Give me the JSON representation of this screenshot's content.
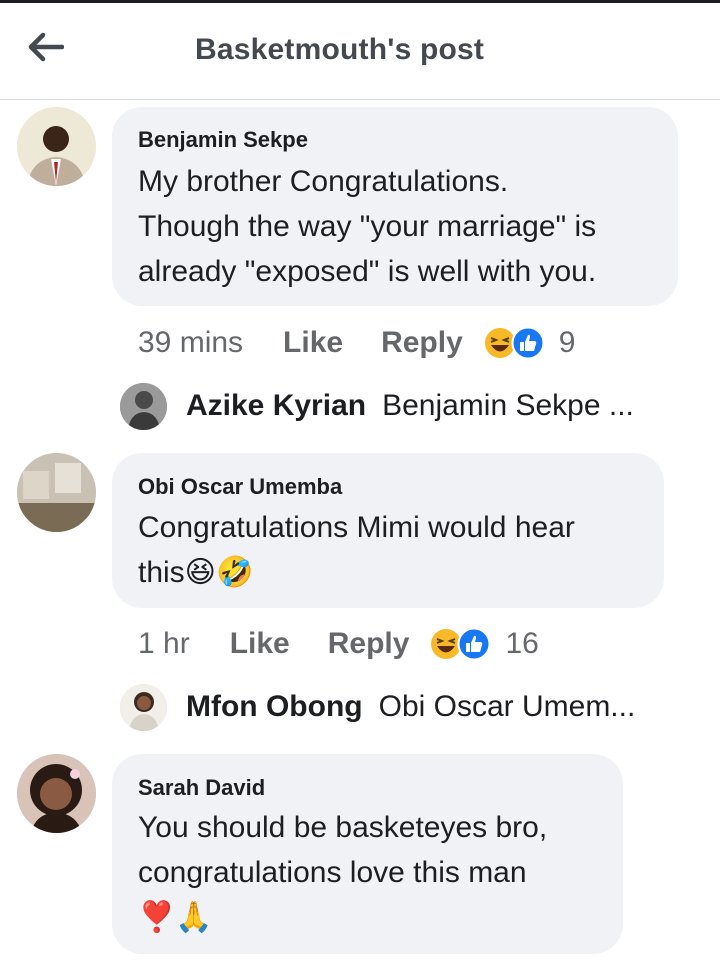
{
  "header": {
    "title": "Basketmouth's post"
  },
  "comments": [
    {
      "author": "Benjamin Sekpe",
      "text": "My brother Congratulations.\nThough the way \"your marriage\" is\nalready \"exposed\" is well with you.",
      "time": "39 mins",
      "like": "Like",
      "reply": "Reply",
      "reaction_count": "9",
      "reply_preview": {
        "author": "Azike Kyrian",
        "text": "Benjamin Sekpe ..."
      }
    },
    {
      "author": "Obi Oscar Umemba",
      "text": "Congratulations Mimi would hear\nthis😆🤣",
      "time": "1 hr",
      "like": "Like",
      "reply": "Reply",
      "reaction_count": "16",
      "reply_preview": {
        "author": "Mfon Obong",
        "text": "Obi Oscar Umem..."
      }
    },
    {
      "author": "Sarah David",
      "text": "You should be basketeyes bro,\ncongratulations love this man\n❣️🙏"
    }
  ],
  "colors": {
    "bubble": "#f0f2f5",
    "meta": "#65676b",
    "like_blue": "#1877f2",
    "haha_yellow": "#f7b928"
  }
}
